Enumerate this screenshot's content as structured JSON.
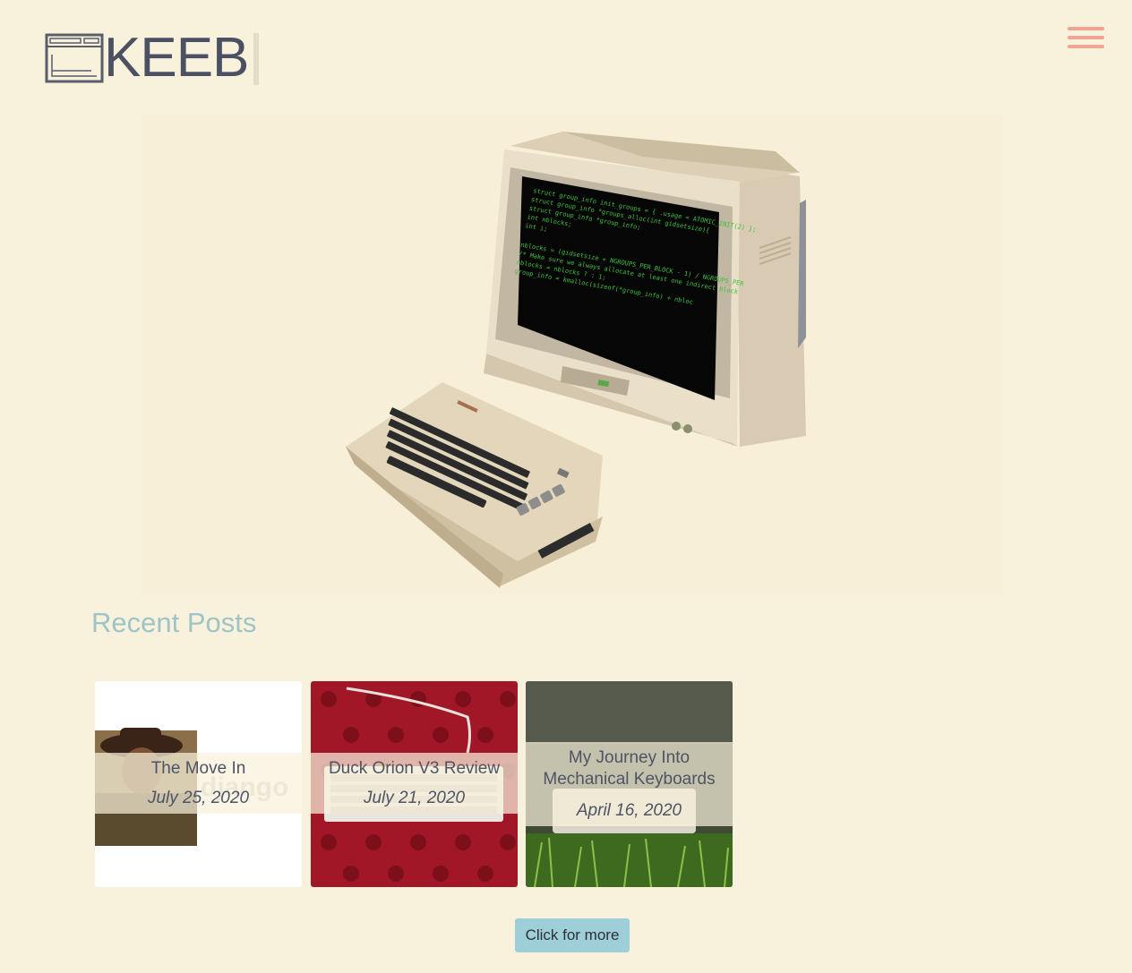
{
  "header": {
    "logo_text": "KEEB",
    "logo_icon": "window-icon",
    "menu_icon": "hamburger-icon"
  },
  "hero": {
    "image": "retro-computer-with-keyboard",
    "screen_lines": [
      "struct group_info init_groups = { .usage = ATOMIC_INIT(2) };",
      "struct group_info *groups_alloc(int gidsetsize){",
      "   struct group_info *group_info;",
      "   int nblocks;",
      "   int i;",
      "",
      "   nblocks = (gidsetsize + NGROUPS_PER_BLOCK - 1) / NGROUPS_PER",
      "   /* Make sure we always allocate at least one indirect block",
      "   nblocks = nblocks ? : 1;",
      "   group_info = kmalloc(sizeof(*group_info) + nbloc"
    ]
  },
  "recent": {
    "title": "Recent Posts",
    "posts": [
      {
        "title": "The Move In",
        "date": "July 25, 2020"
      },
      {
        "title": "Duck Orion V3 Review",
        "date": "July 21, 2020"
      },
      {
        "title": "My Journey Into Mechanical Keyboards",
        "date": "April 16, 2020"
      }
    ],
    "more_label": "Click for more"
  },
  "colors": {
    "background": "#f8f1db",
    "accent": "#9ec4c8",
    "menu": "#f0a594",
    "button": "#9ecfd8"
  }
}
